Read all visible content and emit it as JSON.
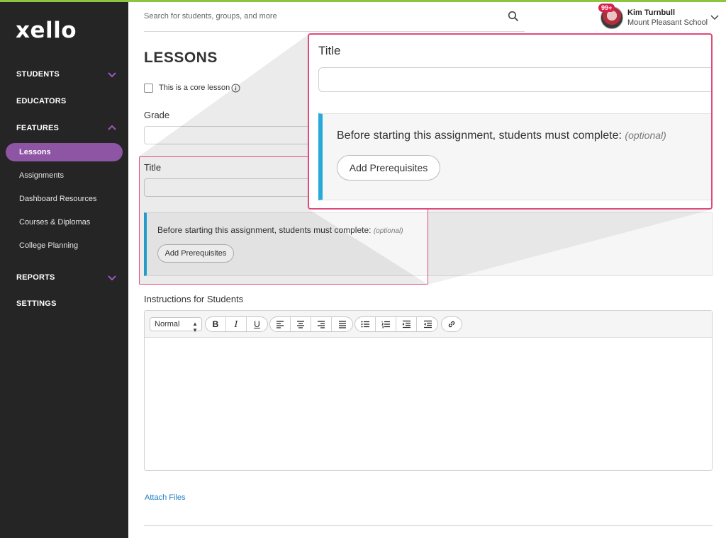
{
  "brand": {
    "logo": "xello"
  },
  "sidebar": {
    "items": [
      {
        "label": "STUDENTS"
      },
      {
        "label": "EDUCATORS"
      },
      {
        "label": "FEATURES"
      },
      {
        "label": "REPORTS"
      },
      {
        "label": "SETTINGS"
      }
    ],
    "features_sub": [
      {
        "label": "Lessons",
        "active": true
      },
      {
        "label": "Assignments"
      },
      {
        "label": "Dashboard Resources"
      },
      {
        "label": "Courses & Diplomas"
      },
      {
        "label": "College Planning"
      }
    ]
  },
  "header": {
    "search_placeholder": "Search for students, groups, and more",
    "user": {
      "name": "Kim Turnbull",
      "school": "Mount Pleasant School",
      "badge": "99+"
    }
  },
  "form": {
    "page_title": "LESSONS",
    "core_lesson_label": "This is a core lesson",
    "grade_label": "Grade",
    "title_label": "Title",
    "prereq_text": "Before starting this assignment, students must complete:",
    "prereq_optional": "(optional)",
    "add_prereq_button": "Add Prerequisites",
    "instructions_label": "Instructions for Students",
    "editor": {
      "format_select": "Normal"
    },
    "attach_files": "Attach Files"
  },
  "colors": {
    "accent_purple": "#8e55a5",
    "callout": "#e04a78",
    "prereq_bar": "#29a9d9",
    "top_bar": "#8cc63f"
  }
}
